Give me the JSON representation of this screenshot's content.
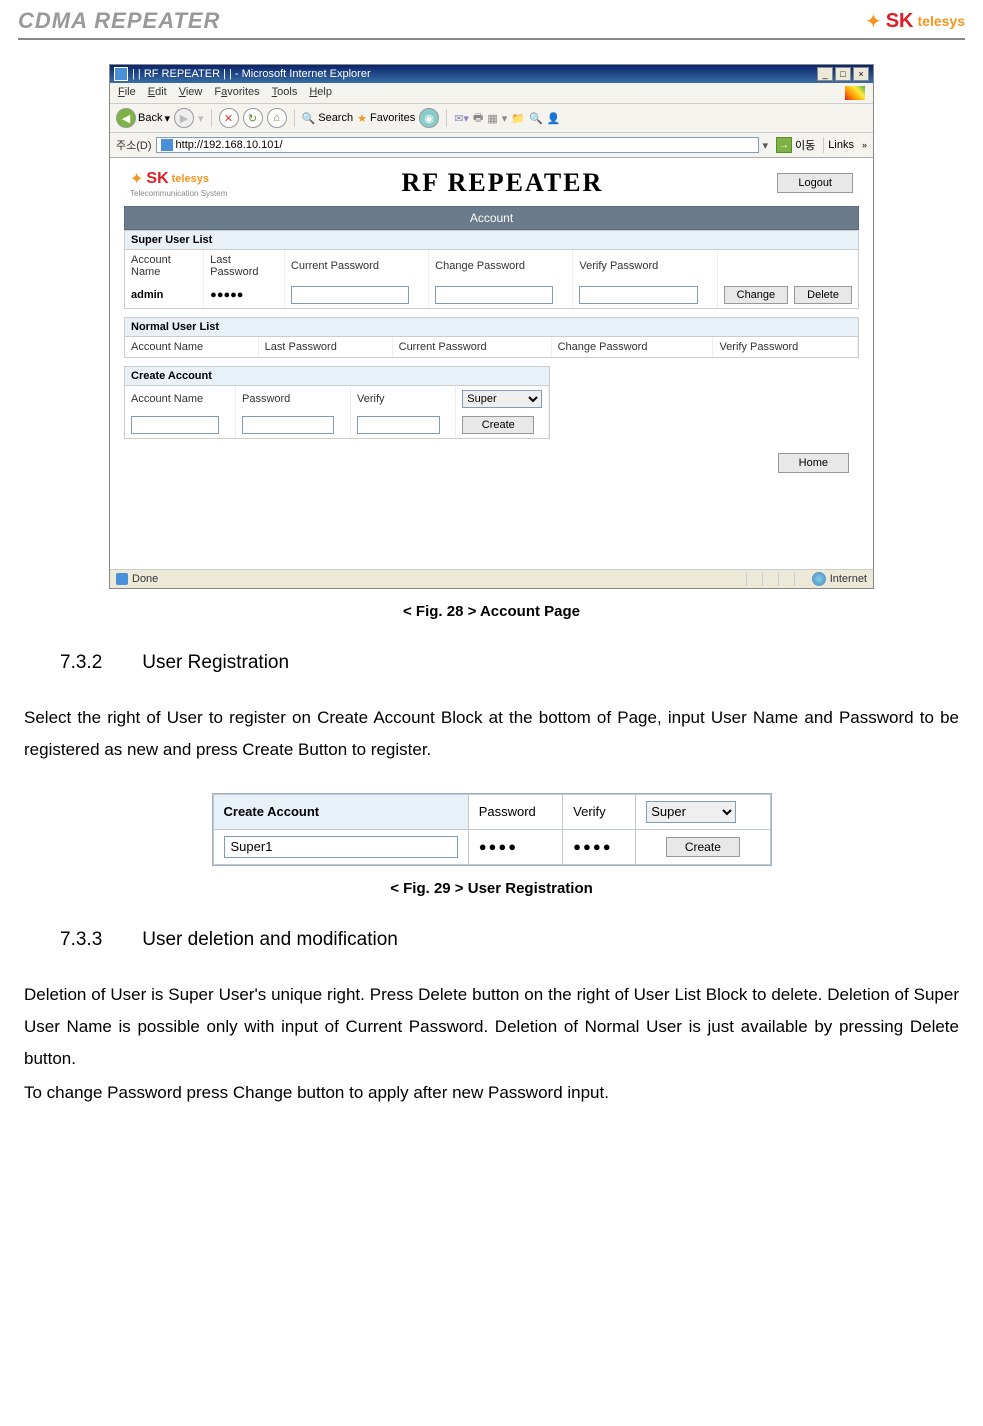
{
  "header": {
    "title": "CDMA REPEATER",
    "logo": {
      "sk": "SK",
      "telesys": "telesys"
    }
  },
  "ie": {
    "title": "| | RF REPEATER | | - Microsoft Internet Explorer",
    "menu": {
      "file": "File",
      "edit": "Edit",
      "view": "View",
      "favorites": "Favorites",
      "tools": "Tools",
      "help": "Help"
    },
    "toolbar": {
      "back": "Back",
      "search": "Search",
      "favorites": "Favorites"
    },
    "addr": {
      "label": "주소(D)",
      "url": "http://192.168.10.101/",
      "go": "이동",
      "links": "Links"
    },
    "status": {
      "done": "Done",
      "internet": "Internet"
    }
  },
  "rf": {
    "title": "RF REPEATER",
    "logo_sub": "Telecommunication System",
    "logout": "Logout",
    "account_head": "Account",
    "super_title": "Super User List",
    "normal_title": "Normal User List",
    "create_title": "Create Account",
    "cols": {
      "account": "Account Name",
      "last": "Last Password",
      "current": "Current Password",
      "change_pw": "Change Password",
      "verify_pw": "Verify Password",
      "password": "Password",
      "verify": "Verify"
    },
    "row": {
      "admin": "admin",
      "dots": "●●●●●"
    },
    "btns": {
      "change": "Change",
      "delete": "Delete",
      "create": "Create",
      "home": "Home"
    },
    "select_val": "Super"
  },
  "fig28": "< Fig. 28 > Account Page",
  "sec732": {
    "num": "7.3.2",
    "title": "User Registration"
  },
  "para1": "Select the right of User to register on Create Account Block at the bottom of Page, input User Name and Password to be registered as new and press Create Button to register.",
  "fig29table": {
    "h1": "Create Account",
    "h2": "Password",
    "h3": "Verify",
    "select": "Super",
    "val1": "Super1",
    "dots": "●●●●",
    "create": "Create"
  },
  "fig29": "< Fig. 29 > User Registration",
  "sec733": {
    "num": "7.3.3",
    "title": "User deletion and modification"
  },
  "para2": "Deletion of User is Super User's unique right. Press Delete button on the right of User List Block to delete. Deletion of Super User Name is possible only with input of Current Password. Deletion of Normal User is just available by pressing Delete button.",
  "para3": "To change Password press Change button to apply after new Password input."
}
